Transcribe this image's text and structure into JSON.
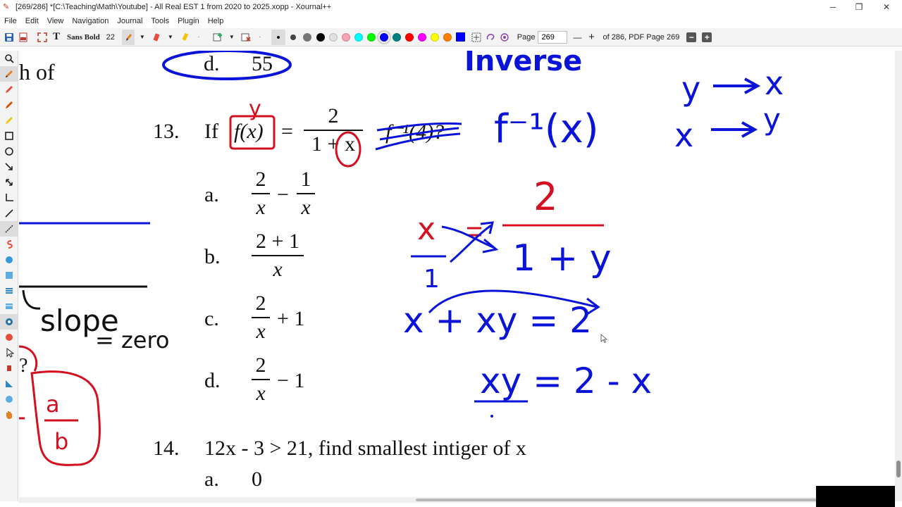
{
  "window": {
    "title": "[269/286]  *[C:\\Teaching\\Math\\Youtube] - All Real EST 1 from 2020 to 2025.xopp - Xournal++",
    "minimize": "─",
    "maximize": "❐",
    "close": "✕"
  },
  "menu": [
    "File",
    "Edit",
    "View",
    "Navigation",
    "Journal",
    "Tools",
    "Plugin",
    "Help"
  ],
  "toolbar": {
    "font_name": "Sans Bold",
    "font_size": "22",
    "page_label": "Page",
    "page_value": "269",
    "page_info": "of 286, PDF Page 269",
    "colors": [
      "#000000",
      "#008000",
      "#00c0ff",
      "#00ff00",
      "#808080",
      "#00ffff",
      "#ff0000",
      "#ff00ff",
      "#ffff00",
      "#ff8000",
      "#0000ff"
    ]
  },
  "document": {
    "prev_fragment": "h of",
    "prev_option_d": "d.",
    "prev_option_d_value": "55",
    "q13_number": "13.",
    "q13_if": "If",
    "q13_fx": "f(x)",
    "q13_eq": "=",
    "q13_num": "2",
    "q13_den": "1 + x",
    "q13_tail": "f⁻¹(4)?",
    "options": [
      {
        "label": "a.",
        "num1": "2",
        "den1": "x",
        "op": "−",
        "num2": "1",
        "den2": "x"
      },
      {
        "label": "b.",
        "num": "2 + 1",
        "den": "x"
      },
      {
        "label": "c.",
        "num": "2",
        "den": "x",
        "tail": "+ 1"
      },
      {
        "label": "d.",
        "num": "2",
        "den": "x",
        "tail": "− 1"
      }
    ],
    "q14_number": "14.",
    "q14_text": "12x - 3 > 21, find smallest intiger of x",
    "q14_a_label": "a.",
    "q14_a_value": "0"
  },
  "annotations": {
    "inverse": "Inverse",
    "f_inverse": "f⁻¹(x)",
    "slope": "slope",
    "zero": "= zero",
    "a_over_b_num": "a",
    "a_over_b_den": "b",
    "q": "?",
    "y_label": "y",
    "x_to": "x",
    "y_to": "y",
    "two": "2",
    "one_plus_y": "1 + y",
    "x_num": "x",
    "x_den": "1",
    "eq_line1": "x + xy = 2",
    "eq_line2": "xy = 2 - x"
  }
}
